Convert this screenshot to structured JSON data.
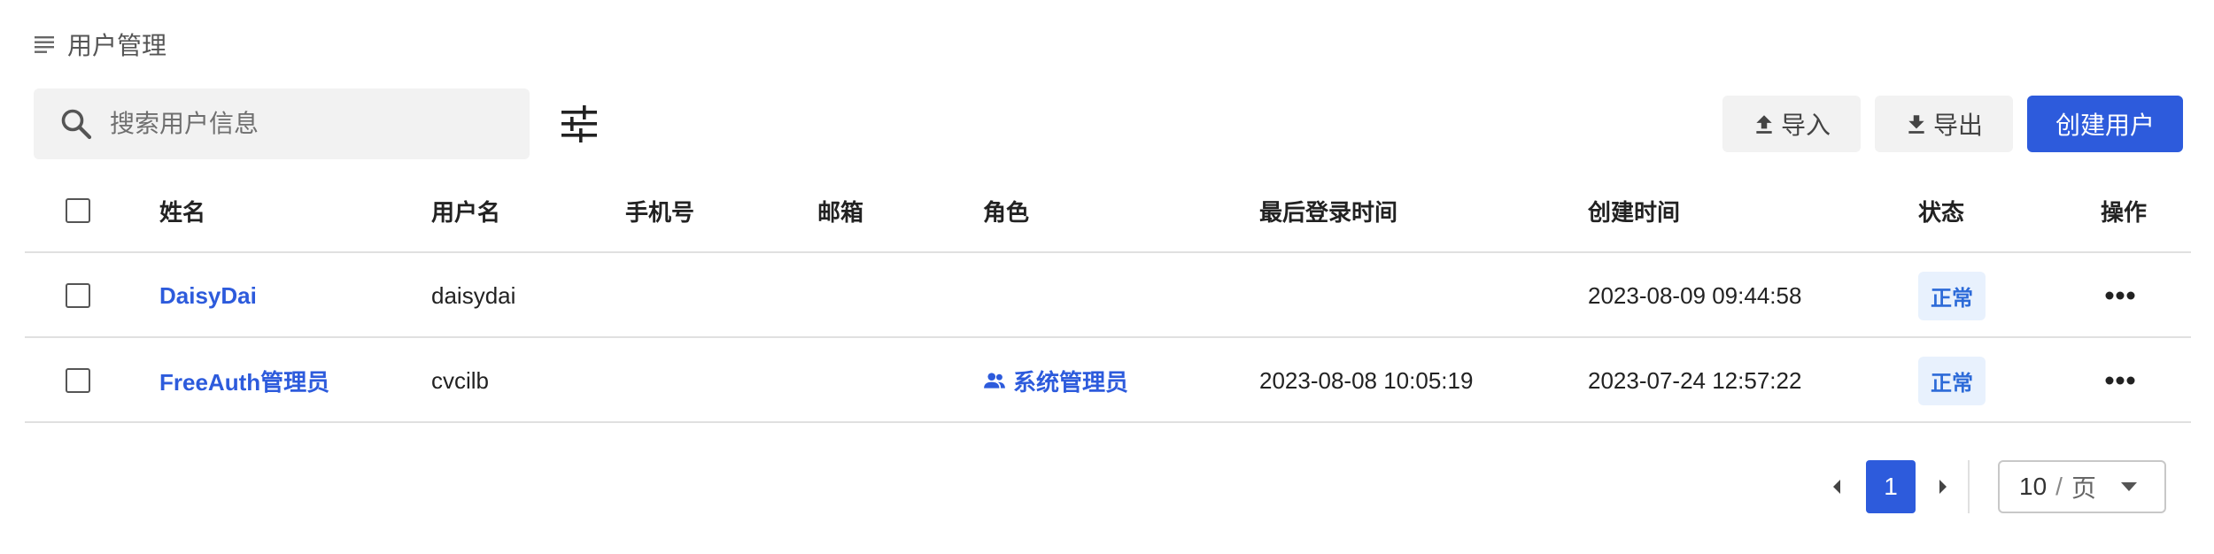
{
  "header": {
    "title": "用户管理"
  },
  "toolbar": {
    "search_placeholder": "搜索用户信息",
    "import_label": "导入",
    "export_label": "导出",
    "create_label": "创建用户"
  },
  "table": {
    "columns": [
      "姓名",
      "用户名",
      "手机号",
      "邮箱",
      "角色",
      "最后登录时间",
      "创建时间",
      "状态",
      "操作"
    ],
    "rows": [
      {
        "name": "DaisyDai",
        "username": "daisydai",
        "phone": "",
        "email": "",
        "role": "",
        "last_login": "",
        "created": "2023-08-09 09:44:58",
        "status": "正常"
      },
      {
        "name": "FreeAuth管理员",
        "username": "cvcilb",
        "phone": "",
        "email": "",
        "role": "系统管理员",
        "last_login": "2023-08-08 10:05:19",
        "created": "2023-07-24 12:57:22",
        "status": "正常"
      }
    ]
  },
  "pagination": {
    "current_page": "1",
    "page_size": "10",
    "separator": "/",
    "unit": "页"
  },
  "icons": {
    "menu": "menu-lines-icon",
    "search": "search-icon",
    "filter": "tune-sliders-icon",
    "import": "upload-icon",
    "export": "download-icon",
    "role": "people-icon",
    "more": "more-horizontal-icon",
    "prev": "chevron-left-icon",
    "next": "chevron-right-icon",
    "dropdown": "caret-down-icon"
  },
  "colors": {
    "primary": "#2d5bdc",
    "badge_bg": "#e8f1fd",
    "badge_text": "#2d6bd8"
  }
}
